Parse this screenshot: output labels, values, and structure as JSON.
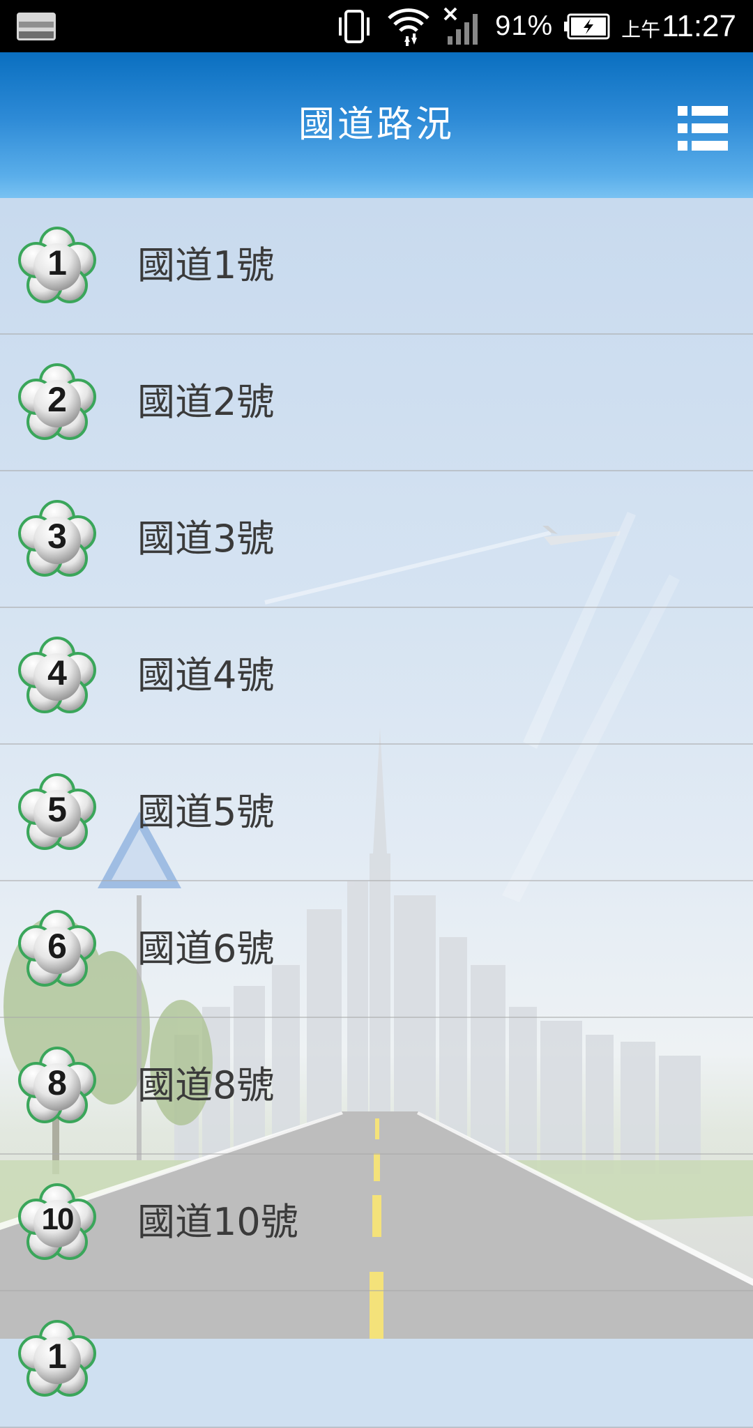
{
  "status_bar": {
    "battery_percent": "91%",
    "time_ampm": "上午",
    "time": "11:27",
    "icons": [
      "screenshot-icon",
      "vibrate-icon",
      "wifi-icon",
      "no-signal-icon",
      "battery-charging-icon"
    ]
  },
  "app_bar": {
    "title": "國道路況",
    "menu_icon": "list-menu-icon"
  },
  "colors": {
    "app_bar_top": "#0a6fc0",
    "app_bar_bottom": "#79c2f2",
    "badge_border": "#3aa65a",
    "label_text": "#3a3a3a"
  },
  "highways": [
    {
      "number": "1",
      "label": "國道1號"
    },
    {
      "number": "2",
      "label": "國道2號"
    },
    {
      "number": "3",
      "label": "國道3號"
    },
    {
      "number": "4",
      "label": "國道4號"
    },
    {
      "number": "5",
      "label": "國道5號"
    },
    {
      "number": "6",
      "label": "國道6號"
    },
    {
      "number": "8",
      "label": "國道8號"
    },
    {
      "number": "10",
      "label": "國道10號"
    },
    {
      "number": "1",
      "label": ""
    }
  ]
}
